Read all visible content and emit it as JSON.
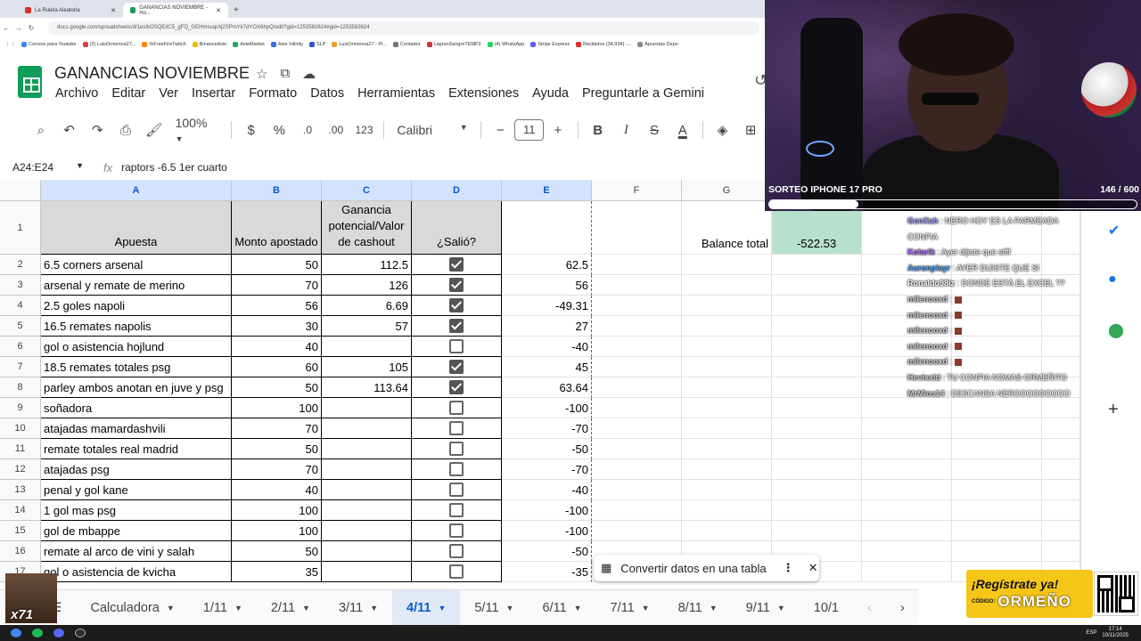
{
  "browser": {
    "tabs": [
      {
        "label": "La Ruleta Aleatoria",
        "active": false,
        "color": "#d93025"
      },
      {
        "label": "GANANCIAS NOVIEMBRE - Ho...",
        "active": true,
        "color": "#0f9d58"
      }
    ],
    "url": "docs.google.com/spreadsheets/d/1esIkOSQEiIC5_gFQ_GEHmsuqrAj2SPmYk7dYOX6hpQ/edit?gid=1253582624#gid=1253582624",
    "bookmarks": [
      "Correos para Youtube",
      "(2) LuisOrmenoa27...",
      "%FreeFireTwitch",
      "BinanceAxie",
      "AxieMarket",
      "Axie Infinity",
      "SLP",
      "LuisOrmenoa27 - Pl...",
      "Contador",
      "LagranSangreTEMP2",
      "(4) WhatsApp",
      "Stripe Express",
      "Recibidos (34,934) -...",
      "Apuestas Depo"
    ]
  },
  "sheets": {
    "title": "GANANCIAS NOVIEMBRE",
    "menu": [
      "Archivo",
      "Editar",
      "Ver",
      "Insertar",
      "Formato",
      "Datos",
      "Herramientas",
      "Extensiones",
      "Ayuda",
      "Preguntarle a Gemini"
    ],
    "toolbar": {
      "zoom": "100%",
      "currency": "$",
      "percent": "%",
      "dec_less": ".0",
      "dec_more": ".00",
      "format123": "123",
      "font": "Calibri",
      "font_size": "11"
    },
    "namebox": "A24:E24",
    "formula": "raptors -6.5 1er cuarto",
    "columns": [
      "A",
      "B",
      "C",
      "D",
      "E",
      "F",
      "G"
    ],
    "headers": {
      "a": "Apuesta",
      "b": "Monto apostado",
      "c": "Ganancia potencial/Valor de cashout",
      "d": "¿Salió?",
      "balance_label": "Balance total",
      "balance_value": "-522.53"
    },
    "rows": [
      {
        "n": "2",
        "a": "6.5 corners arsenal",
        "b": "50",
        "c": "112.5",
        "d": true,
        "e": "62.5"
      },
      {
        "n": "3",
        "a": "arsenal y remate de merino",
        "b": "70",
        "c": "126",
        "d": true,
        "e": "56"
      },
      {
        "n": "4",
        "a": "2.5 goles napoli",
        "b": "56",
        "c": "6.69",
        "d": true,
        "e": "-49.31"
      },
      {
        "n": "5",
        "a": "16.5 remates napolis",
        "b": "30",
        "c": "57",
        "d": true,
        "e": "27"
      },
      {
        "n": "6",
        "a": "gol o asistencia hojlund",
        "b": "40",
        "c": "",
        "d": false,
        "e": "-40"
      },
      {
        "n": "7",
        "a": "18.5 remates totales psg",
        "b": "60",
        "c": "105",
        "d": true,
        "e": "45"
      },
      {
        "n": "8",
        "a": "parley ambos anotan en juve y psg",
        "b": "50",
        "c": "113.64",
        "d": true,
        "e": "63.64"
      },
      {
        "n": "9",
        "a": "soñadora",
        "b": "100",
        "c": "",
        "d": false,
        "e": "-100"
      },
      {
        "n": "10",
        "a": "atajadas mamardashvili",
        "b": "70",
        "c": "",
        "d": false,
        "e": "-70"
      },
      {
        "n": "11",
        "a": "remate totales real madrid",
        "b": "50",
        "c": "",
        "d": false,
        "e": "-50"
      },
      {
        "n": "12",
        "a": "atajadas psg",
        "b": "70",
        "c": "",
        "d": false,
        "e": "-70"
      },
      {
        "n": "13",
        "a": "penal y gol kane",
        "b": "40",
        "c": "",
        "d": false,
        "e": "-40"
      },
      {
        "n": "14",
        "a": "1 gol mas psg",
        "b": "100",
        "c": "",
        "d": false,
        "e": "-100"
      },
      {
        "n": "15",
        "a": "gol de mbappe",
        "b": "100",
        "c": "",
        "d": false,
        "e": "-100"
      },
      {
        "n": "16",
        "a": "remate al arco de vini y salah",
        "b": "50",
        "c": "",
        "d": false,
        "e": "-50"
      },
      {
        "n": "17",
        "a": "gol o asistencia de kvicha",
        "b": "35",
        "c": "",
        "d": false,
        "e": "-35"
      }
    ],
    "sheet_tabs": [
      "Calculadora",
      "1/11",
      "2/11",
      "3/11",
      "4/11",
      "5/11",
      "6/11",
      "7/11",
      "8/11",
      "9/11",
      "10/1"
    ],
    "active_sheet": "4/11",
    "toast": "Convertir datos en una tabla",
    "colors": {
      "header_gray": "#d9d9d9",
      "balance_green": "#b7e1cd",
      "accent": "#0b57d0"
    }
  },
  "stream": {
    "giveaway_label": "SORTEO IPHONE 17 PRO",
    "giveaway_count": "146 / 600",
    "giveaway_progress": 0.243,
    "chat": [
      {
        "user": "GonXah",
        "color": "#a0a0ff",
        "msg": "NERO HOY ES LA FARMEADA CONFIA"
      },
      {
        "user": "Kotarik",
        "color": "#b06cff",
        "msg": "Ayer dijiste que sifff"
      },
      {
        "user": "Auronplayr",
        "color": "#4aa3ff",
        "msg": "AYER DIJISTE QUE SI"
      },
      {
        "user": "Ronaldo98iz",
        "color": "#ffffff",
        "msg": "DONDE ESTÁ EL EXCEL ??"
      },
      {
        "user": "milenooxd",
        "color": "#d0d0d0",
        "msg": ""
      },
      {
        "user": "milenooxd",
        "color": "#d0d0d0",
        "msg": ""
      },
      {
        "user": "milenooxd",
        "color": "#d0d0d0",
        "msg": ""
      },
      {
        "user": "milenooxd",
        "color": "#d0d0d0",
        "msg": ""
      },
      {
        "user": "milenooxd",
        "color": "#d0d0d0",
        "msg": ""
      },
      {
        "user": "Hevixxld",
        "color": "#d0d0d0",
        "msg": "TU CONFIA NOMAS ORMEÑITO"
      },
      {
        "user": "MrMlos14",
        "color": "#d0d0d0",
        "msg": "DESCANSA NEROOOOOOOOO"
      }
    ],
    "promo_line1": "¡Regístrate ya!",
    "promo_code_label": "CÓDIGO:",
    "promo_code": "ORMEÑO",
    "meme_text": "x71"
  },
  "taskbar": {
    "lang": "ESP",
    "time": "17:14",
    "date": "10/11/2025"
  }
}
